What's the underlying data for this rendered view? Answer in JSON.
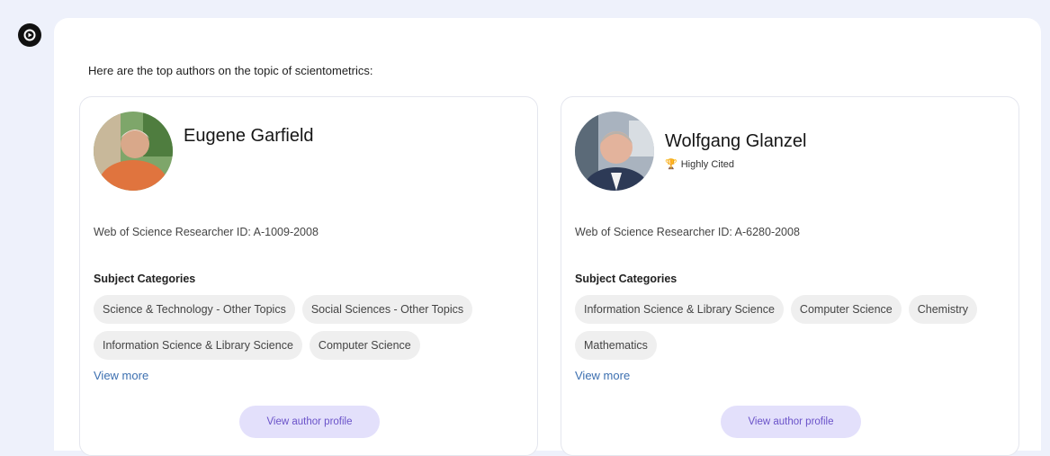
{
  "intro_text": "Here are the top authors on the topic of scientometrics:",
  "authors": [
    {
      "name": "Eugene Garfield",
      "badge": "",
      "researcher_id": "Web of Science Researcher ID: A-1009-2008",
      "subject_title": "Subject Categories",
      "categories": [
        "Science & Technology - Other Topics",
        "Social Sciences - Other Topics",
        "Information Science & Library Science",
        "Computer Science"
      ],
      "view_more": "View more",
      "profile_button": "View author profile"
    },
    {
      "name": "Wolfgang Glanzel",
      "badge": "Highly Cited",
      "researcher_id": "Web of Science Researcher ID: A-6280-2008",
      "subject_title": "Subject Categories",
      "categories": [
        "Information Science & Library Science",
        "Computer Science",
        "Chemistry",
        "Mathematics"
      ],
      "view_more": "View more",
      "profile_button": "View author profile"
    }
  ],
  "colors": {
    "accent": "#6a52c9",
    "button_bg": "#e3e0fb",
    "link": "#3c6fb0",
    "badge_trophy": "#e0583f"
  },
  "icons": {
    "bot": "bot-icon",
    "trophy": "trophy-icon"
  }
}
